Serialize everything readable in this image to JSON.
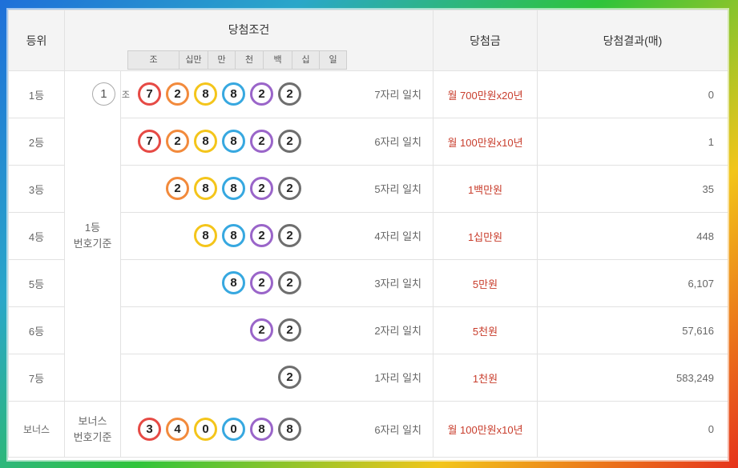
{
  "header": {
    "rank": "등위",
    "condition": "당첨조건",
    "prize": "당첨금",
    "result": "당첨결과(매)",
    "digits": [
      "조",
      "십만",
      "만",
      "천",
      "백",
      "십",
      "일"
    ]
  },
  "group_label_1": "1등\n번호기준",
  "group_label_bonus": "보너스\n번호기준",
  "jo_label": "조",
  "colors": {
    "red": "#e64a45",
    "orange": "#f28a3c",
    "yellow": "#f4c51b",
    "blue": "#37a8e0",
    "purple": "#9a65c9",
    "gray": "#6e6e6e",
    "prize_text": "#c83c2b"
  },
  "rows": [
    {
      "rank": "1등",
      "jo": "1",
      "balls": [
        "7",
        "2",
        "8",
        "8",
        "2",
        "2"
      ],
      "match": "7자리 일치",
      "prize": "월 700만원x20년",
      "result": "0"
    },
    {
      "rank": "2등",
      "balls": [
        "7",
        "2",
        "8",
        "8",
        "2",
        "2"
      ],
      "match": "6자리 일치",
      "prize": "월 100만원x10년",
      "result": "1"
    },
    {
      "rank": "3등",
      "balls": [
        "2",
        "8",
        "8",
        "2",
        "2"
      ],
      "match": "5자리 일치",
      "prize": "1백만원",
      "result": "35"
    },
    {
      "rank": "4등",
      "balls": [
        "8",
        "8",
        "2",
        "2"
      ],
      "match": "4자리 일치",
      "prize": "1십만원",
      "result": "448"
    },
    {
      "rank": "5등",
      "balls": [
        "8",
        "2",
        "2"
      ],
      "match": "3자리 일치",
      "prize": "5만원",
      "result": "6,107"
    },
    {
      "rank": "6등",
      "balls": [
        "2",
        "2"
      ],
      "match": "2자리 일치",
      "prize": "5천원",
      "result": "57,616"
    },
    {
      "rank": "7등",
      "balls": [
        "2"
      ],
      "match": "1자리 일치",
      "prize": "1천원",
      "result": "583,249"
    },
    {
      "rank": "보너스",
      "balls": [
        "3",
        "4",
        "0",
        "0",
        "8",
        "8"
      ],
      "match": "6자리 일치",
      "prize": "월 100만원x10년",
      "result": "0"
    }
  ]
}
